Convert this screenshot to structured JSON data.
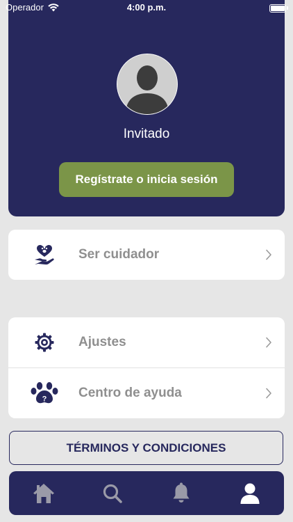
{
  "status_bar": {
    "carrier": "Operador",
    "time": "4:00 p.m."
  },
  "profile": {
    "name": "Invitado",
    "login_button": "Regístrate o inicia sesión"
  },
  "menu_primary": [
    {
      "label": "Ser cuidador",
      "icon": "heart-hand-icon"
    }
  ],
  "menu_secondary": [
    {
      "label": "Ajustes",
      "icon": "gear-icon"
    },
    {
      "label": "Centro de ayuda",
      "icon": "paw-question-icon"
    }
  ],
  "terms_button": "TÉRMINOS Y CONDICIONES",
  "tab_bar": {
    "items": [
      {
        "icon": "home-icon"
      },
      {
        "icon": "search-icon"
      },
      {
        "icon": "bell-icon"
      },
      {
        "icon": "user-icon",
        "active": true
      }
    ]
  },
  "colors": {
    "brand_navy": "#27285d",
    "accent_green": "#7b9548",
    "background": "#e6e6e6",
    "menu_text": "#8f8f8f"
  }
}
